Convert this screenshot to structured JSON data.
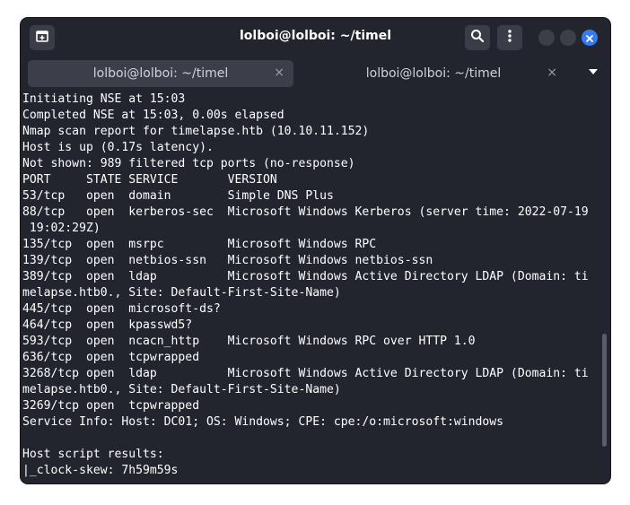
{
  "window": {
    "title": "lolboi@lolboi: ~/timel"
  },
  "titlebar": {
    "new_tab_icon": "new-tab-icon",
    "search_icon": "search-icon",
    "menu_icon": "kebab-menu-icon",
    "close_icon": "close-icon"
  },
  "tabs": [
    {
      "label": "lolboi@lolboi: ~/timel",
      "active": true
    },
    {
      "label": "lolboi@lolboi: ~/timel",
      "active": false
    }
  ],
  "tab_close_glyph": "×",
  "terminal_lines": [
    "Initiating NSE at 15:03",
    "Completed NSE at 15:03, 0.00s elapsed",
    "Nmap scan report for timelapse.htb (10.10.11.152)",
    "Host is up (0.17s latency).",
    "Not shown: 989 filtered tcp ports (no-response)",
    "PORT     STATE SERVICE       VERSION",
    "53/tcp   open  domain        Simple DNS Plus",
    "88/tcp   open  kerberos-sec  Microsoft Windows Kerberos (server time: 2022-07-19",
    " 19:02:29Z)",
    "135/tcp  open  msrpc         Microsoft Windows RPC",
    "139/tcp  open  netbios-ssn   Microsoft Windows netbios-ssn",
    "389/tcp  open  ldap          Microsoft Windows Active Directory LDAP (Domain: ti",
    "melapse.htb0., Site: Default-First-Site-Name)",
    "445/tcp  open  microsoft-ds?",
    "464/tcp  open  kpasswd5?",
    "593/tcp  open  ncacn_http    Microsoft Windows RPC over HTTP 1.0",
    "636/tcp  open  tcpwrapped",
    "3268/tcp open  ldap          Microsoft Windows Active Directory LDAP (Domain: ti",
    "melapse.htb0., Site: Default-First-Site-Name)",
    "3269/tcp open  tcpwrapped",
    "Service Info: Host: DC01; OS: Windows; CPE: cpe:/o:microsoft:windows",
    "",
    "Host script results:",
    "|_clock-skew: 7h59m59s"
  ]
}
